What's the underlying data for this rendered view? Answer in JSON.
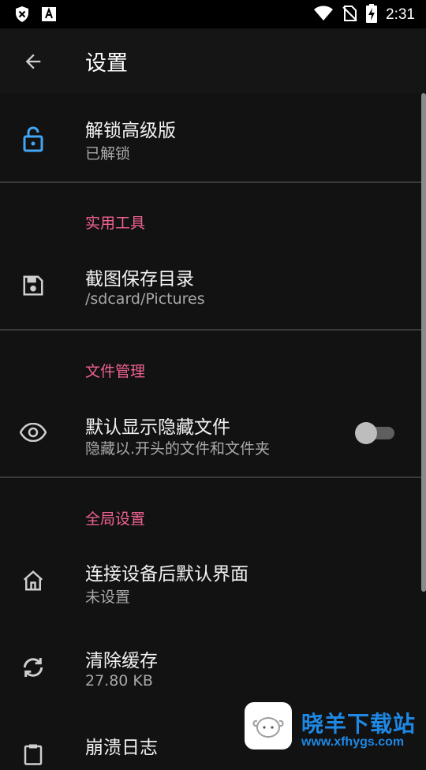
{
  "status_bar": {
    "time": "2:31",
    "icons": [
      "shield-x-icon",
      "a-badge-icon",
      "wifi-icon",
      "no-sim-icon",
      "battery-charging-icon"
    ]
  },
  "toolbar": {
    "title": "设置",
    "back_icon": "arrow-back-icon"
  },
  "preferences": [
    {
      "icon": "lock-open-icon",
      "title": "解锁高级版",
      "summary": "已解锁",
      "icon_color": "#42a5f5"
    },
    {
      "category": "实用工具"
    },
    {
      "icon": "save-icon",
      "title": "截图保存目录",
      "summary": "/sdcard/Pictures"
    },
    {
      "category": "文件管理"
    },
    {
      "icon": "eye-icon",
      "title": "默认显示隐藏文件",
      "summary": "隐藏以.开头的文件和文件夹",
      "switch_on": false
    },
    {
      "category": "全局设置"
    },
    {
      "icon": "home-icon",
      "title": "连接设备后默认界面",
      "summary": "未设置"
    },
    {
      "icon": "refresh-icon",
      "title": "清除缓存",
      "summary": "27.80 KB"
    },
    {
      "icon": "clipboard-icon",
      "title": "崩溃日志"
    }
  ],
  "watermark": {
    "name": "晓羊下载站",
    "url": "www.xfhygs.com"
  },
  "colors": {
    "background": "#121212",
    "accent_category": "#f06292",
    "unlock_icon": "#42a5f5"
  }
}
